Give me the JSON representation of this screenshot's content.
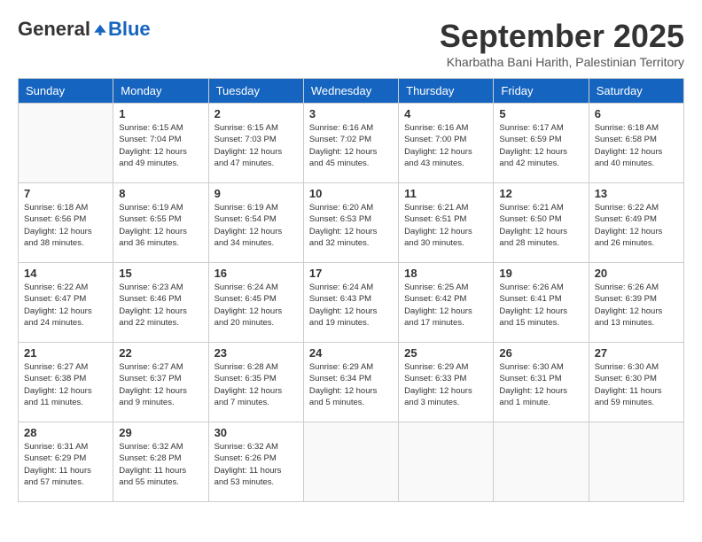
{
  "header": {
    "logo_general": "General",
    "logo_blue": "Blue",
    "month_title": "September 2025",
    "location": "Kharbatha Bani Harith, Palestinian Territory"
  },
  "days_of_week": [
    "Sunday",
    "Monday",
    "Tuesday",
    "Wednesday",
    "Thursday",
    "Friday",
    "Saturday"
  ],
  "weeks": [
    [
      {
        "day": "",
        "info": ""
      },
      {
        "day": "1",
        "info": "Sunrise: 6:15 AM\nSunset: 7:04 PM\nDaylight: 12 hours\nand 49 minutes."
      },
      {
        "day": "2",
        "info": "Sunrise: 6:15 AM\nSunset: 7:03 PM\nDaylight: 12 hours\nand 47 minutes."
      },
      {
        "day": "3",
        "info": "Sunrise: 6:16 AM\nSunset: 7:02 PM\nDaylight: 12 hours\nand 45 minutes."
      },
      {
        "day": "4",
        "info": "Sunrise: 6:16 AM\nSunset: 7:00 PM\nDaylight: 12 hours\nand 43 minutes."
      },
      {
        "day": "5",
        "info": "Sunrise: 6:17 AM\nSunset: 6:59 PM\nDaylight: 12 hours\nand 42 minutes."
      },
      {
        "day": "6",
        "info": "Sunrise: 6:18 AM\nSunset: 6:58 PM\nDaylight: 12 hours\nand 40 minutes."
      }
    ],
    [
      {
        "day": "7",
        "info": "Sunrise: 6:18 AM\nSunset: 6:56 PM\nDaylight: 12 hours\nand 38 minutes."
      },
      {
        "day": "8",
        "info": "Sunrise: 6:19 AM\nSunset: 6:55 PM\nDaylight: 12 hours\nand 36 minutes."
      },
      {
        "day": "9",
        "info": "Sunrise: 6:19 AM\nSunset: 6:54 PM\nDaylight: 12 hours\nand 34 minutes."
      },
      {
        "day": "10",
        "info": "Sunrise: 6:20 AM\nSunset: 6:53 PM\nDaylight: 12 hours\nand 32 minutes."
      },
      {
        "day": "11",
        "info": "Sunrise: 6:21 AM\nSunset: 6:51 PM\nDaylight: 12 hours\nand 30 minutes."
      },
      {
        "day": "12",
        "info": "Sunrise: 6:21 AM\nSunset: 6:50 PM\nDaylight: 12 hours\nand 28 minutes."
      },
      {
        "day": "13",
        "info": "Sunrise: 6:22 AM\nSunset: 6:49 PM\nDaylight: 12 hours\nand 26 minutes."
      }
    ],
    [
      {
        "day": "14",
        "info": "Sunrise: 6:22 AM\nSunset: 6:47 PM\nDaylight: 12 hours\nand 24 minutes."
      },
      {
        "day": "15",
        "info": "Sunrise: 6:23 AM\nSunset: 6:46 PM\nDaylight: 12 hours\nand 22 minutes."
      },
      {
        "day": "16",
        "info": "Sunrise: 6:24 AM\nSunset: 6:45 PM\nDaylight: 12 hours\nand 20 minutes."
      },
      {
        "day": "17",
        "info": "Sunrise: 6:24 AM\nSunset: 6:43 PM\nDaylight: 12 hours\nand 19 minutes."
      },
      {
        "day": "18",
        "info": "Sunrise: 6:25 AM\nSunset: 6:42 PM\nDaylight: 12 hours\nand 17 minutes."
      },
      {
        "day": "19",
        "info": "Sunrise: 6:26 AM\nSunset: 6:41 PM\nDaylight: 12 hours\nand 15 minutes."
      },
      {
        "day": "20",
        "info": "Sunrise: 6:26 AM\nSunset: 6:39 PM\nDaylight: 12 hours\nand 13 minutes."
      }
    ],
    [
      {
        "day": "21",
        "info": "Sunrise: 6:27 AM\nSunset: 6:38 PM\nDaylight: 12 hours\nand 11 minutes."
      },
      {
        "day": "22",
        "info": "Sunrise: 6:27 AM\nSunset: 6:37 PM\nDaylight: 12 hours\nand 9 minutes."
      },
      {
        "day": "23",
        "info": "Sunrise: 6:28 AM\nSunset: 6:35 PM\nDaylight: 12 hours\nand 7 minutes."
      },
      {
        "day": "24",
        "info": "Sunrise: 6:29 AM\nSunset: 6:34 PM\nDaylight: 12 hours\nand 5 minutes."
      },
      {
        "day": "25",
        "info": "Sunrise: 6:29 AM\nSunset: 6:33 PM\nDaylight: 12 hours\nand 3 minutes."
      },
      {
        "day": "26",
        "info": "Sunrise: 6:30 AM\nSunset: 6:31 PM\nDaylight: 12 hours\nand 1 minute."
      },
      {
        "day": "27",
        "info": "Sunrise: 6:30 AM\nSunset: 6:30 PM\nDaylight: 11 hours\nand 59 minutes."
      }
    ],
    [
      {
        "day": "28",
        "info": "Sunrise: 6:31 AM\nSunset: 6:29 PM\nDaylight: 11 hours\nand 57 minutes."
      },
      {
        "day": "29",
        "info": "Sunrise: 6:32 AM\nSunset: 6:28 PM\nDaylight: 11 hours\nand 55 minutes."
      },
      {
        "day": "30",
        "info": "Sunrise: 6:32 AM\nSunset: 6:26 PM\nDaylight: 11 hours\nand 53 minutes."
      },
      {
        "day": "",
        "info": ""
      },
      {
        "day": "",
        "info": ""
      },
      {
        "day": "",
        "info": ""
      },
      {
        "day": "",
        "info": ""
      }
    ]
  ]
}
